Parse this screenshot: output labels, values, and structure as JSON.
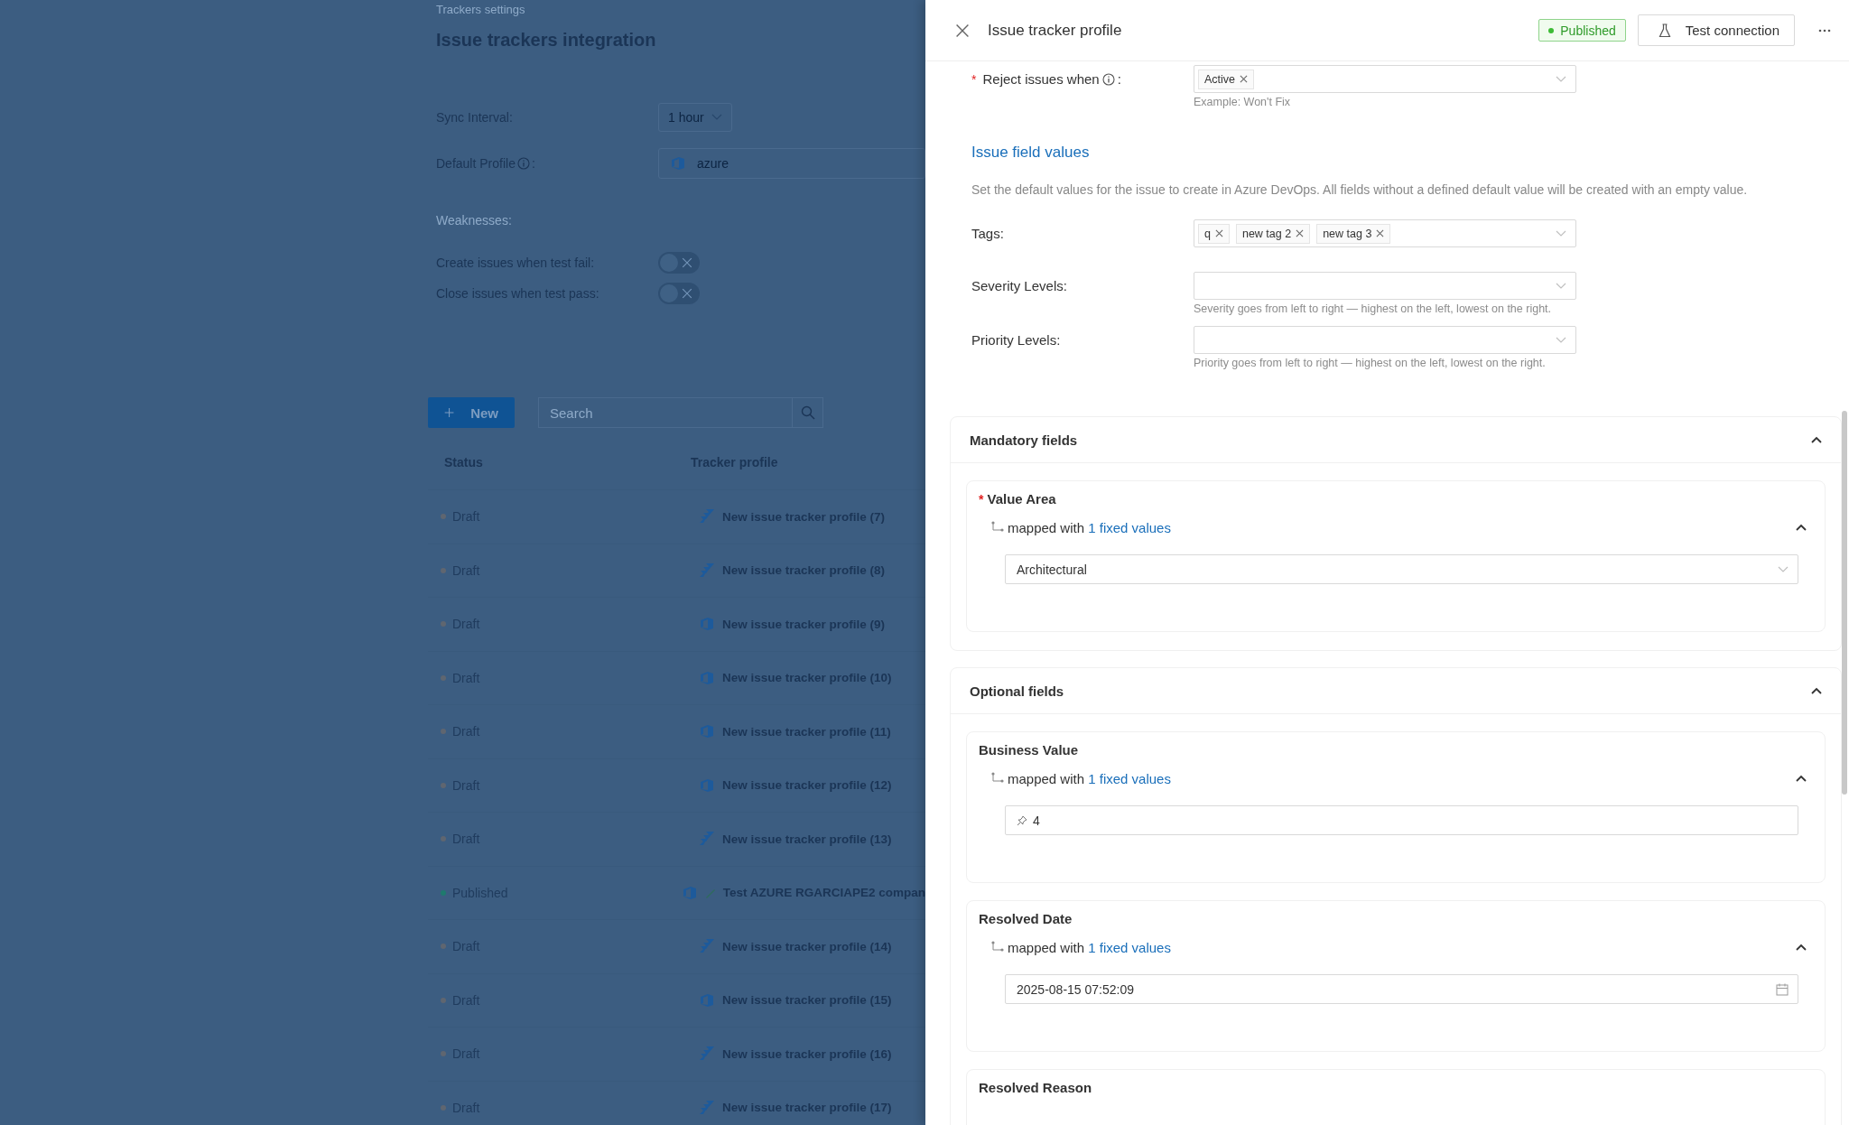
{
  "background_page": {
    "breadcrumb": "Trackers settings",
    "title": "Issue trackers integration",
    "settings": [
      {
        "kind": "select",
        "label": "Sync Interval:",
        "value": "1 hour"
      },
      {
        "kind": "profile",
        "label": "Default Profile",
        "suffix": ":",
        "value": "azure"
      }
    ],
    "section_label": "Weaknesses:",
    "toggles": [
      {
        "label": "Create issues when test fail:",
        "on": false
      },
      {
        "label": "Close issues when test pass:",
        "on": false
      }
    ],
    "new_button": "New",
    "search": {
      "placeholder": "Search"
    },
    "table": {
      "columns": [
        "Status",
        "Tracker profile"
      ],
      "rows": [
        {
          "status": "Draft",
          "color": "#5f6670",
          "kind": "jira",
          "profile": "New issue tracker profile (7)",
          "edited": false
        },
        {
          "status": "Draft",
          "color": "#5f6670",
          "kind": "jira",
          "profile": "New issue tracker profile (8)",
          "edited": false
        },
        {
          "status": "Draft",
          "color": "#5f6670",
          "kind": "azure",
          "profile": "New issue tracker profile (9)",
          "edited": false
        },
        {
          "status": "Draft",
          "color": "#5f6670",
          "kind": "azure",
          "profile": "New issue tracker profile (10)",
          "edited": false
        },
        {
          "status": "Draft",
          "color": "#5f6670",
          "kind": "azure",
          "profile": "New issue tracker profile (11)",
          "edited": false
        },
        {
          "status": "Draft",
          "color": "#5f6670",
          "kind": "azure",
          "profile": "New issue tracker profile (12)",
          "edited": false
        },
        {
          "status": "Draft",
          "color": "#5f6670",
          "kind": "jira",
          "profile": "New issue tracker profile (13)",
          "edited": false
        },
        {
          "status": "Published",
          "color": "#1f7a6e",
          "kind": "azure",
          "profile": "Test AZURE RGARCIAPE2 compan",
          "edited": true
        },
        {
          "status": "Draft",
          "color": "#5f6670",
          "kind": "jira",
          "profile": "New issue tracker profile (14)",
          "edited": false
        },
        {
          "status": "Draft",
          "color": "#5f6670",
          "kind": "azure",
          "profile": "New issue tracker profile (15)",
          "edited": false
        },
        {
          "status": "Draft",
          "color": "#5f6670",
          "kind": "jira",
          "profile": "New issue tracker profile (16)",
          "edited": false
        },
        {
          "status": "Draft",
          "color": "#5f6670",
          "kind": "jira",
          "profile": "New issue tracker profile (17)",
          "edited": false
        }
      ]
    }
  },
  "panel": {
    "title": "Issue tracker profile",
    "status_badge": "Published",
    "test_button": "Test connection",
    "reject": {
      "label": "Reject issues when",
      "suffix": ":",
      "marker": "*",
      "tags": [
        "Active"
      ],
      "hint": "Example: Won't Fix"
    },
    "section_title": "Issue field values",
    "description": "Set the default values for the issue to create in Azure DevOps. All fields without a defined default value will be created with an empty value.",
    "fields": [
      {
        "label": "Tags:",
        "tags": [
          "q",
          "new tag 2",
          "new tag 3"
        ]
      },
      {
        "label": "Severity Levels:",
        "hint": "Severity goes from left to right — highest on the left, lowest on the right."
      },
      {
        "label": "Priority Levels:",
        "hint": "Priority goes from left to right — highest on the left, lowest on the right."
      }
    ],
    "groups": [
      {
        "title": "Mandatory fields",
        "expanded": true,
        "items": [
          {
            "title": "Value Area",
            "marker": "*",
            "mapping": "mapped with",
            "link": "1 fixed values",
            "expanded": true,
            "input": {
              "kind": "select",
              "value": "Architectural"
            }
          }
        ]
      },
      {
        "title": "Optional fields",
        "expanded": true,
        "items": [
          {
            "title": "Business Value",
            "mapping": "mapped with",
            "link": "1 fixed values",
            "expanded": true,
            "input": {
              "kind": "pinned",
              "value": "4"
            }
          },
          {
            "title": "Resolved Date",
            "mapping": "mapped with",
            "link": "1 fixed values",
            "expanded": true,
            "input": {
              "kind": "date",
              "value": "2025-08-15 07:52:09"
            }
          },
          {
            "title": "Resolved Reason"
          }
        ]
      }
    ]
  }
}
